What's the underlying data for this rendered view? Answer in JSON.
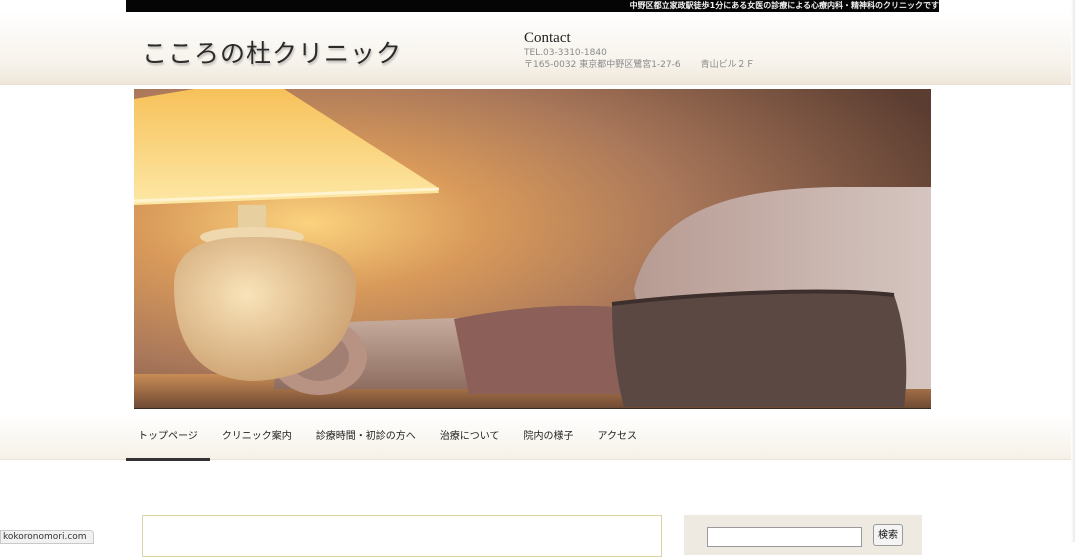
{
  "topbar": {
    "tagline": "中野区都立家政駅徒歩1分にある女医の診療による心療内科・精神科のクリニックです"
  },
  "header": {
    "site_title": "こころの杜クリニック",
    "contact": {
      "heading": "Contact",
      "tel": "TEL.03-3310-1840",
      "address": "〒165-0032 東京都中野区鷺宮1-27-6",
      "building": "青山ビル２Ｆ"
    }
  },
  "nav": {
    "items": [
      {
        "label": "トップページ",
        "active": true
      },
      {
        "label": "クリニック案内"
      },
      {
        "label": "診療時間・初診の方へ"
      },
      {
        "label": "治療について"
      },
      {
        "label": "院内の様子"
      },
      {
        "label": "アクセス"
      }
    ]
  },
  "sidebar": {
    "search": {
      "value": "",
      "button_label": "検索"
    }
  },
  "status_bar": {
    "url": "kokoronomori.com"
  },
  "hero": {
    "image": "living-room-lamp-sofa-photo"
  }
}
